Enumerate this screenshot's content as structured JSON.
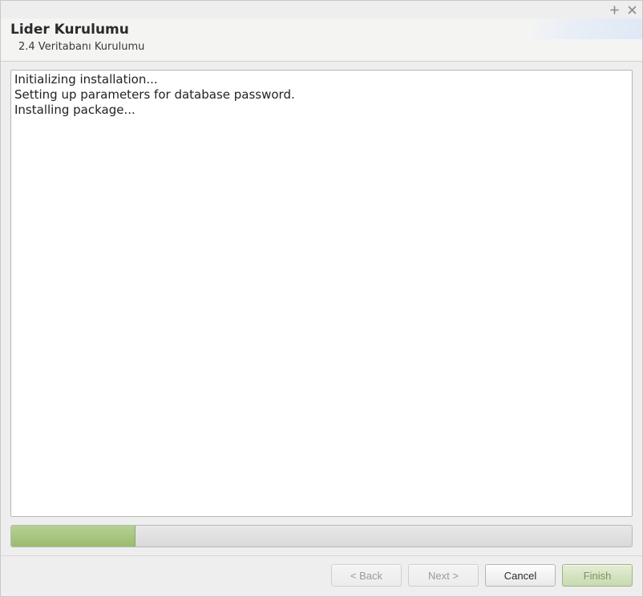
{
  "header": {
    "title": "Lider Kurulumu",
    "subtitle": "2.4 Veritabanı Kurulumu"
  },
  "log": [
    "Initializing installation...",
    "Setting up parameters for database password.",
    "Installing package..."
  ],
  "progress": {
    "percent": 20
  },
  "buttons": {
    "back": "< Back",
    "next": "Next >",
    "cancel": "Cancel",
    "finish": "Finish"
  }
}
